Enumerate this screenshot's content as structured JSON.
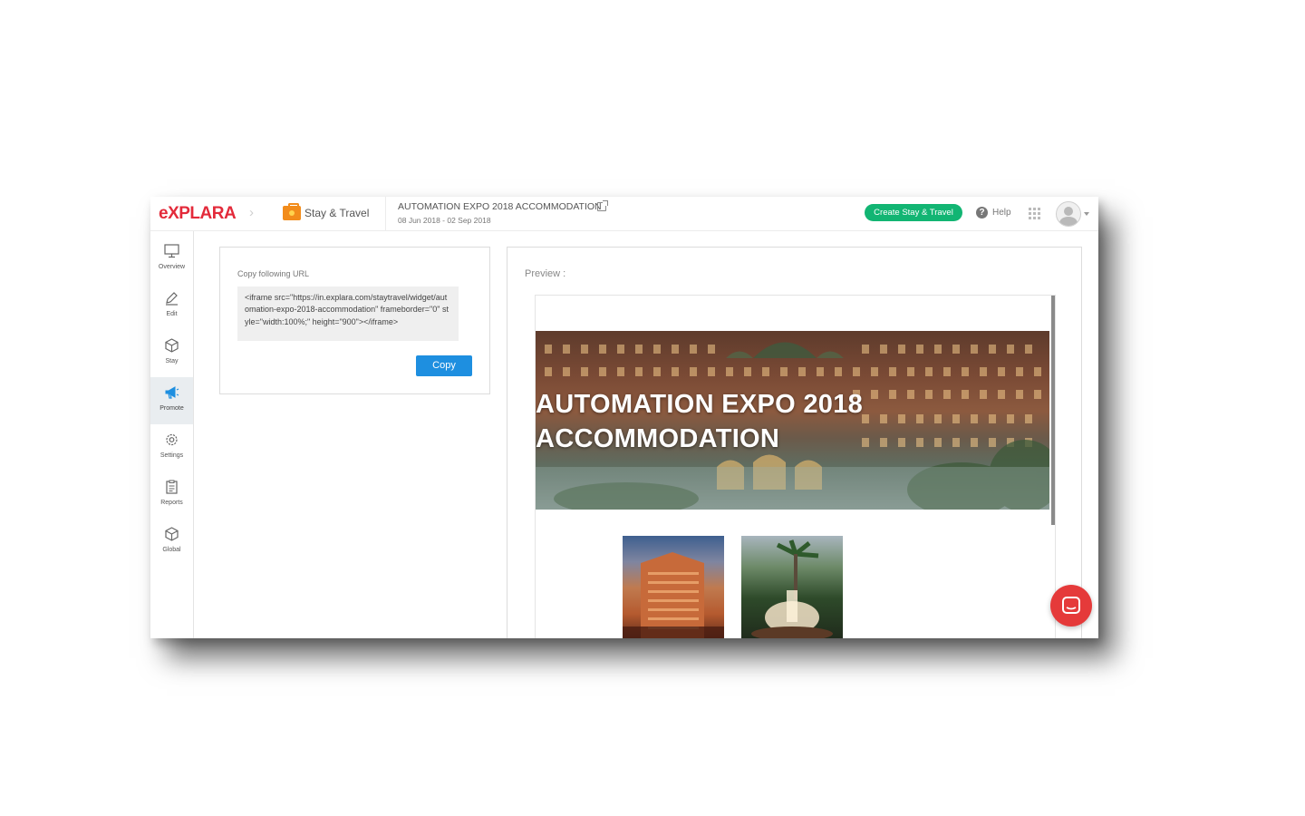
{
  "header": {
    "logo": "eXPLARA",
    "breadcrumb_label": "Stay & Travel",
    "event_title": "AUTOMATION EXPO 2018 ACCOMMODATION",
    "event_dates": "08 Jun 2018 - 02 Sep 2018",
    "create_button": "Create Stay & Travel",
    "help_label": "Help"
  },
  "sidebar": {
    "items": [
      {
        "label": "Overview",
        "icon": "monitor-icon"
      },
      {
        "label": "Edit",
        "icon": "pencil-icon"
      },
      {
        "label": "Stay",
        "icon": "cube-icon"
      },
      {
        "label": "Promote",
        "icon": "megaphone-icon",
        "active": true
      },
      {
        "label": "Settings",
        "icon": "gear-icon"
      },
      {
        "label": "Reports",
        "icon": "clipboard-icon"
      },
      {
        "label": "Global",
        "icon": "cube-icon"
      }
    ]
  },
  "url_card": {
    "label": "Copy following URL",
    "code": "<iframe src=\"https://in.explara.com/staytravel/widget/automation-expo-2018-accommodation\" frameborder=\"0\" style=\"width:100%;\" height=\"900\"></iframe>",
    "copy_button": "Copy"
  },
  "preview": {
    "label": "Preview :",
    "banner_title_line1": "AUTOMATION EXPO 2018",
    "banner_title_line2": "ACCOMMODATION"
  },
  "colors": {
    "brand": "#e32a3a",
    "create_button": "#12b573",
    "copy_button": "#1e8fe0",
    "chat_widget": "#e53a3a",
    "active_sidebar": "#e9edf0"
  }
}
